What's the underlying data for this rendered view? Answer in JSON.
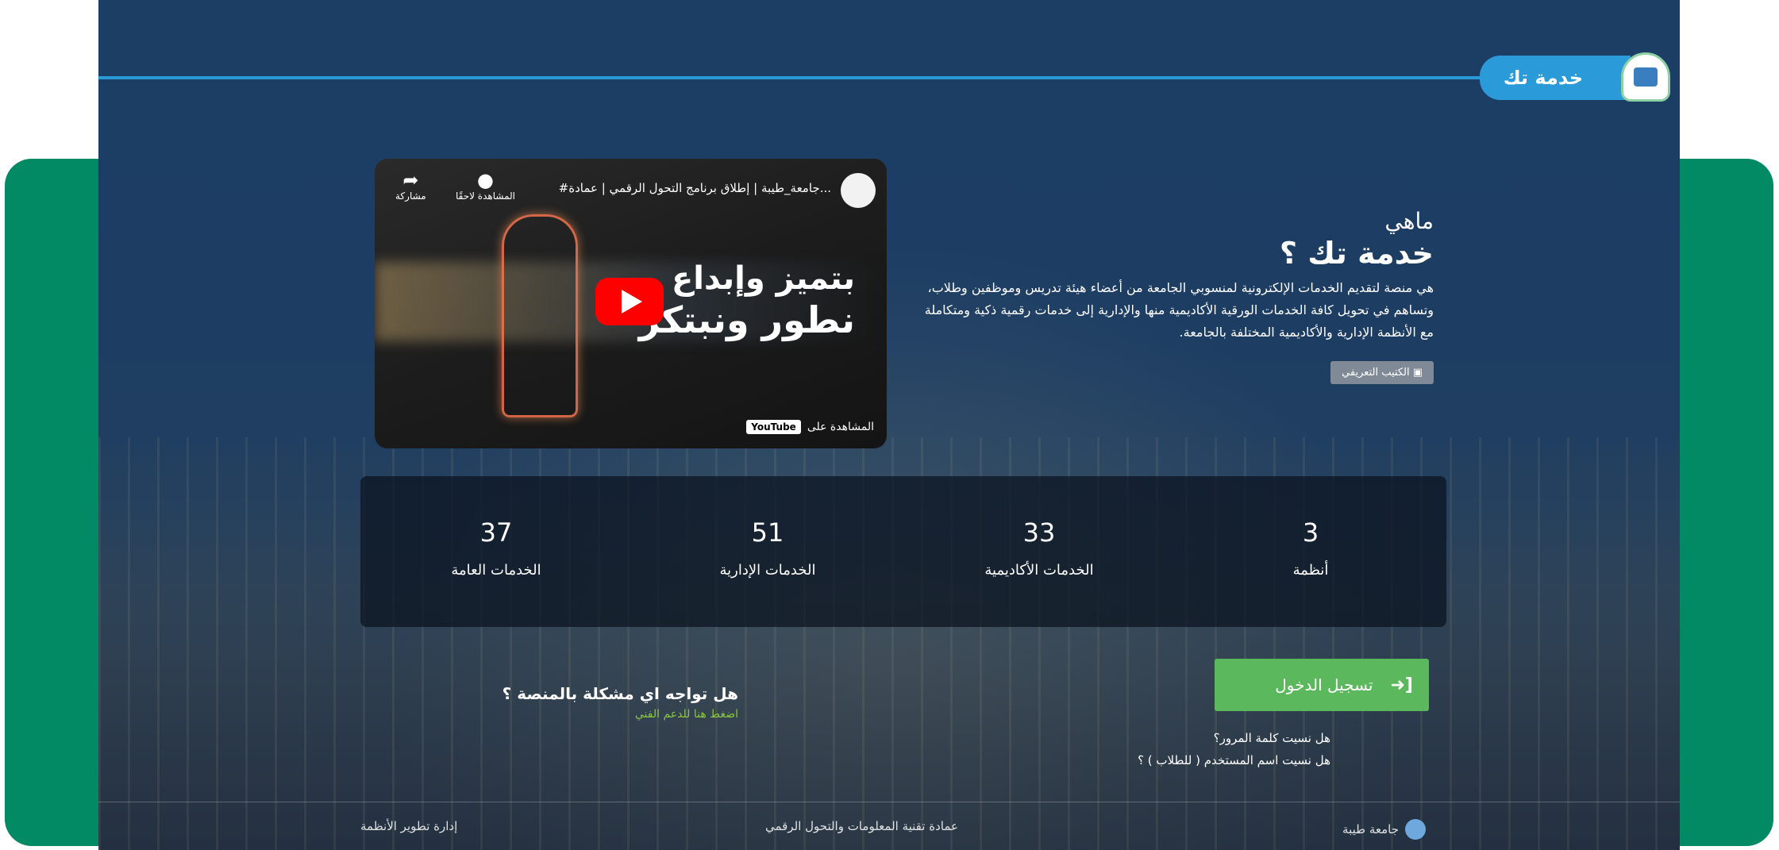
{
  "brand": {
    "name": "خدمة تك"
  },
  "video": {
    "title": "#جامعة_طيبة | إطلاق برنامج التحول الرقمي | عمادة...",
    "watch_later": "المشاهدة لاحقًا",
    "share": "مشاركة",
    "line1": "بتميز وإبداع",
    "line2": "نطور ونبتكر",
    "watch_on": "المشاهدة على",
    "youtube": "YouTube"
  },
  "about": {
    "pre": "ماهي",
    "title": "خدمة تك ؟",
    "description": "هي منصة لتقديم الخدمات الإلكترونية لمنسوبي الجامعة من أعضاء هيئة تدريس وموظفين وطلاب، وتساهم في تحويل كافة الخدمات الورقية الأكاديمية منها والإدارية إلى خدمات رقمية ذكية ومتكاملة مع الأنظمة الإدارية والأكاديمية المختلفة بالجامعة.",
    "button": "الكتيب التعريفي"
  },
  "stats": [
    {
      "value": "3",
      "label": "أنظمة"
    },
    {
      "value": "33",
      "label": "الخدمات الأكاديمية"
    },
    {
      "value": "51",
      "label": "الخدمات الإدارية"
    },
    {
      "value": "37",
      "label": "الخدمات العامة"
    }
  ],
  "login": {
    "button": "تسجيل الدخول",
    "forgot_password": "هل نسيت كلمة المرور؟",
    "forgot_username": "هل نسيت اسم المستخدم ( للطلاب ) ؟"
  },
  "support": {
    "title": "هل تواجه اي مشكلة بالمنصة ؟",
    "link": "اضغط هنا للدعم الفني"
  },
  "footer": {
    "university": "جامعة طيبة",
    "deanship": "عمادة تقنية المعلومات والتحول الرقمي",
    "systems": "إدارة تطوير الأنظمة"
  },
  "colors": {
    "green_card": "#018a64",
    "accent_blue": "#2a9bd8",
    "login_green": "#5cb85c",
    "support_link": "#8cc63f"
  }
}
